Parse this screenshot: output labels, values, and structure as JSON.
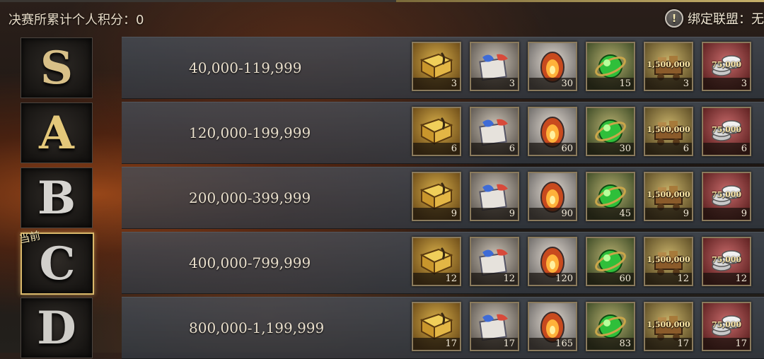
{
  "header": {
    "score_label": "决赛所累计个人积分：0",
    "alliance_label": "绑定联盟：无"
  },
  "current_label": "当前",
  "tiers": [
    {
      "letter": "S",
      "range": "40,000-119,999",
      "color": "#d8c088",
      "quantities": [
        "3",
        "3",
        "30",
        "15",
        "3",
        "3"
      ]
    },
    {
      "letter": "A",
      "range": "120,000-199,999",
      "color": "#e4c87a",
      "quantities": [
        "6",
        "6",
        "60",
        "30",
        "6",
        "6"
      ]
    },
    {
      "letter": "B",
      "range": "200,000-399,999",
      "color": "#d6d4d0",
      "quantities": [
        "9",
        "9",
        "90",
        "45",
        "9",
        "9"
      ]
    },
    {
      "letter": "C",
      "range": "400,000-799,999",
      "color": "#d2d0cc",
      "quantities": [
        "12",
        "12",
        "120",
        "60",
        "12",
        "12"
      ],
      "current": true
    },
    {
      "letter": "D",
      "range": "800,000-1,199,999",
      "color": "#cfcdc8",
      "quantities": [
        "17",
        "17",
        "165",
        "83",
        "17",
        "17"
      ]
    }
  ],
  "reward_items": [
    {
      "icon": "book-icon",
      "tag": ""
    },
    {
      "icon": "dragon-map-icon",
      "tag": ""
    },
    {
      "icon": "fire-egg-icon",
      "tag": ""
    },
    {
      "icon": "green-orb-icon",
      "tag": ""
    },
    {
      "icon": "resource-cart-icon",
      "tag": "1,500,000"
    },
    {
      "icon": "silver-coins-icon",
      "tag": "75,000"
    }
  ]
}
